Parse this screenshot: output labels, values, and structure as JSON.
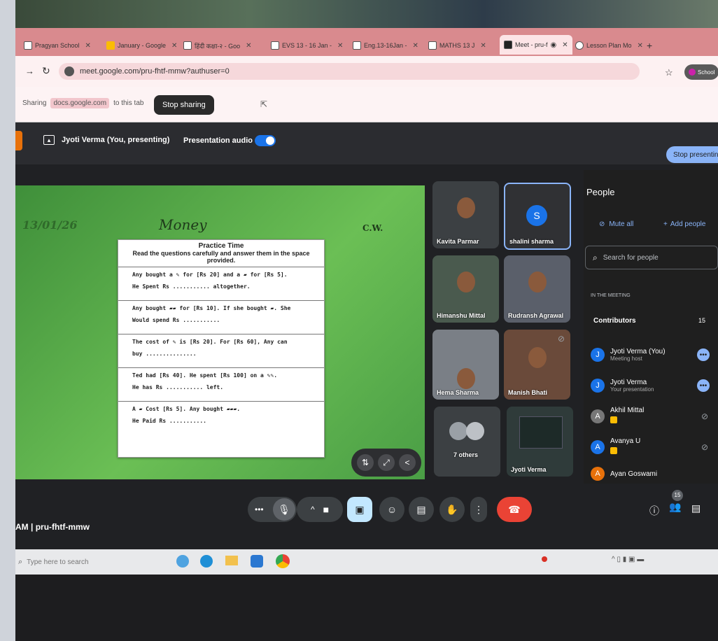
{
  "tabs": [
    {
      "label": "Pragyan School"
    },
    {
      "label": "January - Google"
    },
    {
      "label": "हिंदी कक्षा-२ - Goo"
    },
    {
      "label": "EVS 13 - 16 Jan -"
    },
    {
      "label": "Eng.13-16Jan -"
    },
    {
      "label": "MATHS 13 J"
    },
    {
      "label": "Meet - pru-f"
    },
    {
      "label": "Lesson Plan Mo"
    }
  ],
  "url": "meet.google.com/pru-fhtf-mmw?authuser=0",
  "sharing": {
    "prefix": "Sharing",
    "domain": "docs.google.com",
    "suffix": "to this tab",
    "stop_label": "Stop sharing"
  },
  "profile_label": "School",
  "presenter": {
    "name": "Jyoti Verma (You, presenting)",
    "audio_label": "Presentation audio",
    "stop_label": "Stop presenting"
  },
  "slide": {
    "date": "13/01/26",
    "title": "Money",
    "cw": "C.W.",
    "sheet_title": "Practice Time",
    "instruction": "Read the questions carefully and answer them in the space provided.",
    "rows": [
      {
        "l1": "Any bought a ✎ for [Rs 20] and a ▰ for [Rs 5].",
        "l2": "He Spent Rs ........... altogether."
      },
      {
        "l1": "Any bought ▰▰ for [Rs 10]. If she bought ▰. She",
        "l2": "Would spend Rs ..........."
      },
      {
        "l1": "The cost of ✎ is [Rs 20]. For [Rs 60], Any can",
        "l2": "buy ..............."
      },
      {
        "l1": "Ted had [Rs 40]. He spent [Rs 100] on a ✎✎.",
        "l2": "He has Rs ........... left."
      },
      {
        "l1": "A ▰ Cost [Rs 5]. Any bought ▰▰▰.",
        "l2": "He Paid Rs ..........."
      }
    ]
  },
  "participants": [
    {
      "name": "Kavita Parmar"
    },
    {
      "name": "shalini sharma",
      "initial": "S"
    },
    {
      "name": "Himanshu Mittal"
    },
    {
      "name": "Rudransh Agrawal"
    },
    {
      "name": "Hema Sharma"
    },
    {
      "name": "Manish Bhati"
    },
    {
      "name": "7 others"
    },
    {
      "name": "Jyoti Verma"
    }
  ],
  "people_panel": {
    "title": "People",
    "mute_all": "Mute all",
    "add_people": "Add people",
    "search_placeholder": "Search for people",
    "section": "IN THE MEETING",
    "contributors_label": "Contributors",
    "contributors_count": "15",
    "list": [
      {
        "initial": "J",
        "name": "Jyoti Verma (You)",
        "sub": "Meeting host"
      },
      {
        "initial": "J",
        "name": "Jyoti Verma",
        "sub": "Your presentation"
      },
      {
        "initial": "A",
        "name": "Akhil Mittal",
        "sub": ""
      },
      {
        "initial": "A",
        "name": "Avanya U",
        "sub": ""
      },
      {
        "initial": "A",
        "name": "Ayan Goswami",
        "sub": ""
      }
    ]
  },
  "meeting_code": "AM | pru-fhtf-mmw",
  "people_badge": "15",
  "taskbar": {
    "search_placeholder": "Type here to search"
  },
  "colors": {
    "accent": "#8ab4f8",
    "end_call": "#ea4335",
    "tab_strip": "#d98a8e"
  }
}
